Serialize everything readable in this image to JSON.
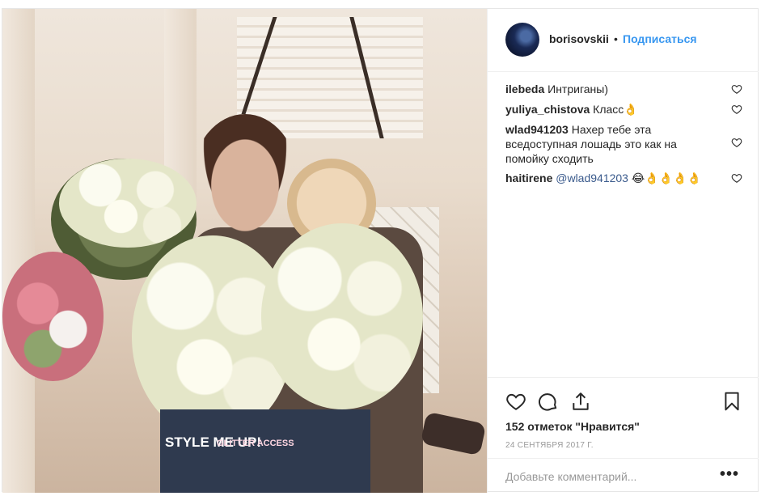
{
  "post": {
    "username": "borisovskii",
    "separator": "•",
    "follow_label": "Подписаться",
    "comments": [
      {
        "user": "ilebeda",
        "text": "Интриганы)"
      },
      {
        "user": "yuliya_chistova",
        "text": "Класс👌"
      },
      {
        "user": "wlad941203",
        "text": "Нахер тебе эта вседоступная лошадь это как на помойку сходить"
      },
      {
        "user": "haitirene",
        "mention": "@wlad941203",
        "text": " 😂👌👌👌👌"
      }
    ],
    "likes": "152 отметок \"Нравится\"",
    "date": "24 СЕНТЯБРЯ 2017 Г.",
    "add_comment_placeholder": "Добавьте комментарий...",
    "more_label": "•••",
    "magazine_title": "STYLE ME UP!",
    "magazine_sub": "GLITTER ACCESS"
  },
  "icons": [
    "like-icon",
    "comment-icon",
    "share-icon",
    "bookmark-icon",
    "heart-icon"
  ],
  "colors": {
    "link": "#3897f0",
    "text": "#262626",
    "muted": "#999999",
    "border": "#efefef"
  }
}
